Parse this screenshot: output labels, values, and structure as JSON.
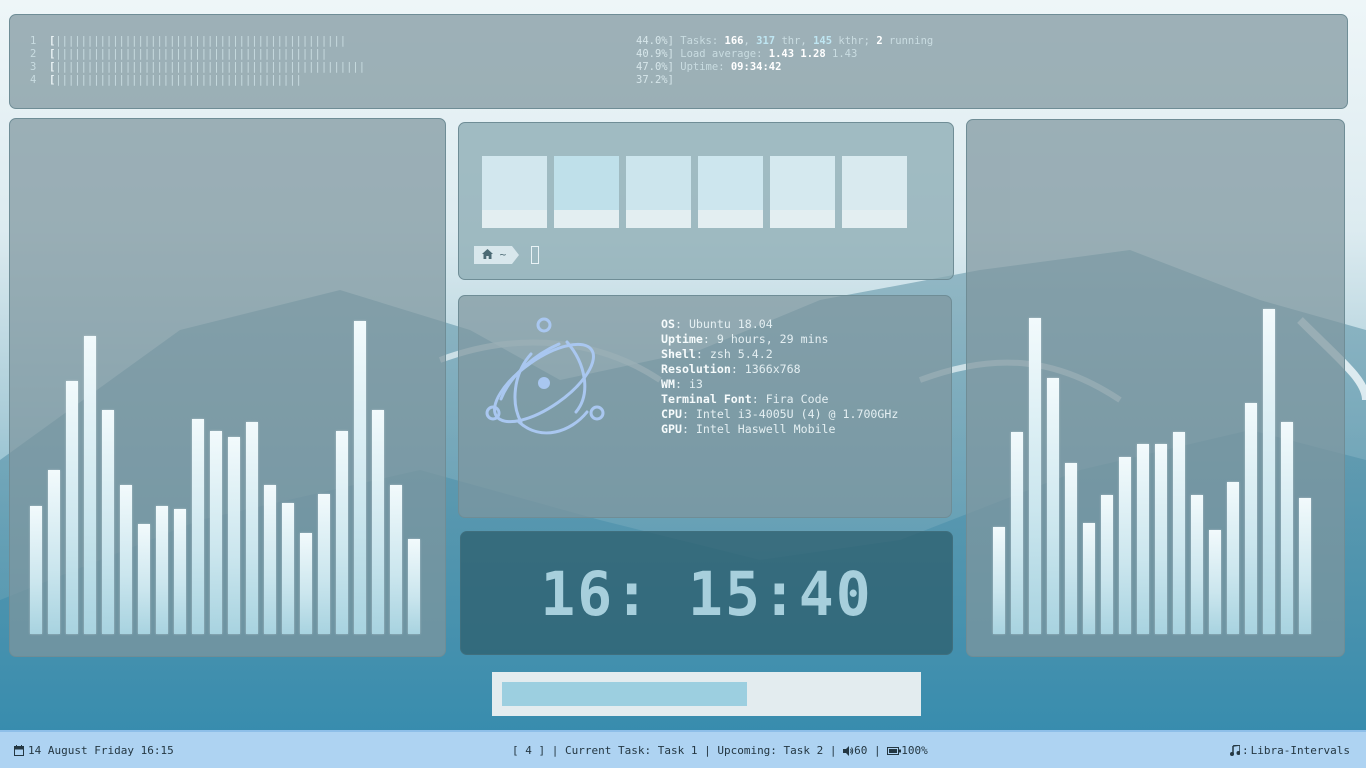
{
  "htop": {
    "cpus": [
      {
        "num": "1",
        "bar": "||||||||||||||||||||||||||||||||||||||||||||||",
        "pct": "44.0%]"
      },
      {
        "num": "2",
        "bar": "|||||||||||||||||||||||||||||||||||||||||||",
        "pct": "40.9%]"
      },
      {
        "num": "3",
        "bar": "|||||||||||||||||||||||||||||||||||||||||||||||||",
        "pct": "47.0%]"
      },
      {
        "num": "4",
        "bar": "|||||||||||||||||||||||||||||||||||||||",
        "pct": "37.2%]"
      }
    ],
    "tasks_label": "Tasks:",
    "tasks": "166",
    "thr": "317",
    "thr_label": "thr,",
    "kthr": "145",
    "kthr_label": "kthr;",
    "running": "2",
    "running_label": "running",
    "load_label": "Load average:",
    "load1": "1.43",
    "load5": "1.28",
    "load15": "1.43",
    "uptime_label": "Uptime:",
    "uptime": "09:34:42"
  },
  "visualizer_left": {
    "levels": [
      0.43,
      0.55,
      0.85,
      1.0,
      0.75,
      0.5,
      0.37,
      0.43,
      0.42,
      0.72,
      0.68,
      0.66,
      0.71,
      0.5,
      0.44,
      0.34,
      0.47,
      0.68,
      1.05,
      0.75,
      0.5,
      0.32
    ]
  },
  "visualizer_right": {
    "levels": [
      0.34,
      0.64,
      1.0,
      0.81,
      0.54,
      0.35,
      0.44,
      0.56,
      0.6,
      0.6,
      0.64,
      0.44,
      0.33,
      0.48,
      0.73,
      1.03,
      0.67,
      0.43
    ]
  },
  "workspaces": {
    "count": 6,
    "prompt_dir": "~"
  },
  "neofetch": {
    "rows": [
      {
        "key": "OS",
        "value": "Ubuntu 18.04"
      },
      {
        "key": "Uptime",
        "value": "9 hours, 29 mins"
      },
      {
        "key": "Shell",
        "value": "zsh 5.4.2"
      },
      {
        "key": "Resolution",
        "value": "1366x768"
      },
      {
        "key": "WM",
        "value": "i3"
      },
      {
        "key": "Terminal Font",
        "value": "Fira Code"
      },
      {
        "key": "CPU",
        "value": "Intel i3-4005U (4) @ 1.700GHz"
      },
      {
        "key": "GPU",
        "value": "Intel Haswell Mobile"
      }
    ]
  },
  "clock": {
    "time": "16: 15:40"
  },
  "progress": {
    "fraction": 0.57
  },
  "statusbar": {
    "date": "14 August Friday 16:15",
    "workspace": "[ 4 ]",
    "current_task": "Current Task: Task 1",
    "upcoming": "Upcoming: Task 2",
    "volume": "60",
    "battery": "100%",
    "music_sep": ":",
    "music": "Libra-Intervals"
  },
  "colors": {
    "accent": "#aed3f2",
    "panel": "#7e969e",
    "bar": "#cbe6ee",
    "clock": "#a7cfdc"
  }
}
